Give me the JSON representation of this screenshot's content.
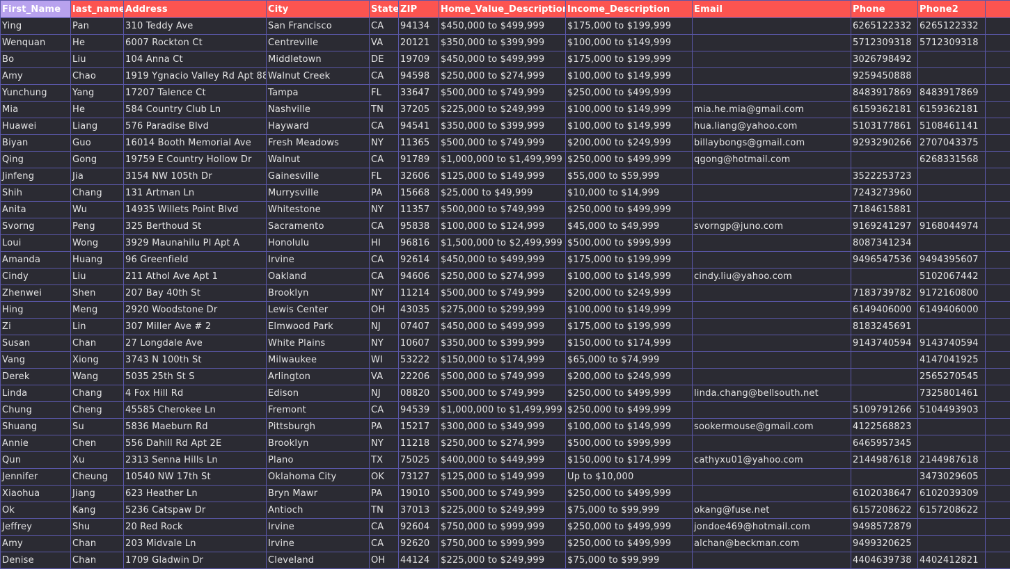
{
  "sheet": {
    "columns": [
      "First_Name",
      "last_name",
      "Address",
      "City",
      "State",
      "ZIP",
      "Home_Value_Description",
      "Income_Description",
      "Email",
      "Phone",
      "Phone2",
      ""
    ],
    "rows": [
      [
        "Ying",
        "Pan",
        "310 Teddy Ave",
        "San Francisco",
        "CA",
        "94134",
        "$450,000 to $499,999",
        "$175,000 to $199,999",
        "",
        "6265122332",
        "6265122332",
        ""
      ],
      [
        "Wenquan",
        "He",
        "6007 Rockton Ct",
        "Centreville",
        "VA",
        "20121",
        "$350,000 to $399,999",
        "$100,000 to $149,999",
        "",
        "5712309318",
        "5712309318",
        ""
      ],
      [
        "Bo",
        "Liu",
        "104 Anna Ct",
        "Middletown",
        "DE",
        "19709",
        "$450,000 to $499,999",
        "$175,000 to $199,999",
        "",
        "3026798492",
        "",
        ""
      ],
      [
        "Amy",
        "Chao",
        "1919 Ygnacio Valley Rd Apt 88",
        "Walnut Creek",
        "CA",
        "94598",
        "$250,000 to $274,999",
        "$100,000 to $149,999",
        "",
        "9259450888",
        "",
        ""
      ],
      [
        "Yunchung",
        "Yang",
        "17207 Talence Ct",
        "Tampa",
        "FL",
        "33647",
        "$500,000 to $749,999",
        "$250,000 to $499,999",
        "",
        "8483917869",
        "8483917869",
        ""
      ],
      [
        "Mia",
        "He",
        "584 Country Club Ln",
        "Nashville",
        "TN",
        "37205",
        "$225,000 to $249,999",
        "$100,000 to $149,999",
        "mia.he.mia@gmail.com",
        "6159362181",
        "6159362181",
        ""
      ],
      [
        "Huawei",
        "Liang",
        "576 Paradise Blvd",
        "Hayward",
        "CA",
        "94541",
        "$350,000 to $399,999",
        "$100,000 to $149,999",
        "hua.liang@yahoo.com",
        "5103177861",
        "5108461141",
        ""
      ],
      [
        "Biyan",
        "Guo",
        "16014 Booth Memorial Ave",
        "Fresh Meadows",
        "NY",
        "11365",
        "$500,000 to $749,999",
        "$200,000 to $249,999",
        "billaybongs@gmail.com",
        "9293290266",
        "2707043375",
        ""
      ],
      [
        "Qing",
        "Gong",
        "19759 E Country Hollow Dr",
        "Walnut",
        "CA",
        "91789",
        "$1,000,000 to $1,499,999",
        "$250,000 to $499,999",
        "qgong@hotmail.com",
        "",
        "6268331568",
        ""
      ],
      [
        "Jinfeng",
        "Jia",
        "3154 NW 105th Dr",
        "Gainesville",
        "FL",
        "32606",
        "$125,000 to $149,999",
        "$55,000 to $59,999",
        "",
        "3522253723",
        "",
        ""
      ],
      [
        "Shih",
        "Chang",
        "131 Artman Ln",
        "Murrysville",
        "PA",
        "15668",
        "$25,000 to $49,999",
        "$10,000 to $14,999",
        "",
        "7243273960",
        "",
        ""
      ],
      [
        "Anita",
        "Wu",
        "14935 Willets Point Blvd",
        "Whitestone",
        "NY",
        "11357",
        "$500,000 to $749,999",
        "$250,000 to $499,999",
        "",
        "7184615881",
        "",
        ""
      ],
      [
        "Svorng",
        "Peng",
        "325 Berthoud St",
        "Sacramento",
        "CA",
        "95838",
        "$100,000  to $124,999",
        "$45,000 to $49,999",
        "svorngp@juno.com",
        "9169241297",
        "9168044974",
        ""
      ],
      [
        "Loui",
        "Wong",
        "3929 Maunahilu Pl Apt A",
        "Honolulu",
        "HI",
        "96816",
        "$1,500,000 to $2,499,999",
        "$500,000 to $999,999",
        "",
        "8087341234",
        "",
        ""
      ],
      [
        "Amanda",
        "Huang",
        "96 Greenfield",
        "Irvine",
        "CA",
        "92614",
        "$450,000 to $499,999",
        "$175,000 to $199,999",
        "",
        "9496547536",
        "9494395607",
        ""
      ],
      [
        "Cindy",
        "Liu",
        "211 Athol Ave Apt 1",
        "Oakland",
        "CA",
        "94606",
        "$250,000 to $274,999",
        "$100,000 to $149,999",
        "cindy.liu@yahoo.com",
        "",
        "5102067442",
        ""
      ],
      [
        "Zhenwei",
        "Shen",
        "207 Bay 40th St",
        "Brooklyn",
        "NY",
        "11214",
        "$500,000 to $749,999",
        "$200,000 to $249,999",
        "",
        "7183739782",
        "9172160800",
        ""
      ],
      [
        "Hing",
        "Meng",
        "2920 Woodstone Dr",
        "Lewis Center",
        "OH",
        "43035",
        "$275,000 to $299,999",
        "$100,000 to $149,999",
        "",
        "6149406000",
        "6149406000",
        ""
      ],
      [
        "Zi",
        "Lin",
        "307 Miller Ave # 2",
        "Elmwood Park",
        "NJ",
        "07407",
        "$450,000 to $499,999",
        "$175,000 to $199,999",
        "",
        "8183245691",
        "",
        ""
      ],
      [
        "Susan",
        "Chan",
        "27 Longdale Ave",
        "White Plains",
        "NY",
        "10607",
        "$350,000 to $399,999",
        "$150,000 to $174,999",
        "",
        "9143740594",
        "9143740594",
        ""
      ],
      [
        "Vang",
        "Xiong",
        "3743 N 100th St",
        "Milwaukee",
        "WI",
        "53222",
        "$150,000 to $174,999",
        "$65,000 to $74,999",
        "",
        "",
        "4147041925",
        ""
      ],
      [
        "Derek",
        "Wang",
        "5035 25th St S",
        "Arlington",
        "VA",
        "22206",
        "$500,000 to $749,999",
        "$200,000 to $249,999",
        "",
        "",
        "2565270545",
        ""
      ],
      [
        "Linda",
        "Chang",
        "4 Fox Hill Rd",
        "Edison",
        "NJ",
        "08820",
        "$500,000 to $749,999",
        "$250,000 to $499,999",
        "linda.chang@bellsouth.net",
        "",
        "7325801461",
        ""
      ],
      [
        "Chung",
        "Cheng",
        "45585 Cherokee Ln",
        "Fremont",
        "CA",
        "94539",
        "$1,000,000 to $1,499,999",
        "$250,000 to $499,999",
        "",
        "5109791266",
        "5104493903",
        ""
      ],
      [
        "Shuang",
        "Su",
        "5836 Maeburn Rd",
        "Pittsburgh",
        "PA",
        "15217",
        "$300,000 to $349,999",
        "$100,000 to $149,999",
        "sookermouse@gmail.com",
        "4122568823",
        "",
        ""
      ],
      [
        "Annie",
        "Chen",
        "556 Dahill Rd Apt 2E",
        "Brooklyn",
        "NY",
        "11218",
        "$250,000 to $274,999",
        "$500,000 to $999,999",
        "",
        "6465957345",
        "",
        ""
      ],
      [
        "Qun",
        "Xu",
        "2313 Senna Hills Ln",
        "Plano",
        "TX",
        "75025",
        "$400,000 to $449,999",
        "$150,000 to $174,999",
        "cathyxu01@yahoo.com",
        "2144987618",
        "2144987618",
        ""
      ],
      [
        "Jennifer",
        "Cheung",
        "10540 NW 17th St",
        "Oklahoma City",
        "OK",
        "73127",
        "$125,000 to $149,999",
        "Up to $10,000",
        "",
        "",
        "3473029605",
        ""
      ],
      [
        "Xiaohua",
        "Jiang",
        "623 Heather Ln",
        "Bryn Mawr",
        "PA",
        "19010",
        "$500,000 to $749,999",
        "$250,000 to $499,999",
        "",
        "6102038647",
        "6102039309",
        ""
      ],
      [
        "Ok",
        "Kang",
        "5236 Catspaw Dr",
        "Antioch",
        "TN",
        "37013",
        "$225,000 to $249,999",
        "$75,000 to $99,999",
        "okang@fuse.net",
        "6157208622",
        "6157208622",
        ""
      ],
      [
        "Jeffrey",
        "Shu",
        "20 Red Rock",
        "Irvine",
        "CA",
        "92604",
        "$750,000 to $999,999",
        "$250,000 to $499,999",
        "jondoe469@hotmail.com",
        "9498572879",
        "",
        ""
      ],
      [
        "Amy",
        "Chan",
        "203 Midvale Ln",
        "Irvine",
        "CA",
        "92620",
        "$750,000 to $999,999",
        "$250,000 to $499,999",
        "alchan@beckman.com",
        "9499320625",
        "",
        ""
      ],
      [
        "Denise",
        "Chan",
        "1709 Gladwin Dr",
        "Cleveland",
        "OH",
        "44124",
        "$225,000 to $249,999",
        "$75,000 to $99,999",
        "",
        "4404639738",
        "4402412821",
        ""
      ]
    ]
  },
  "colors": {
    "header_bg": "#fc5450",
    "selected_header_bg": "#b8a2ee",
    "cell_bg": "#2b2b33",
    "grid_line": "#5a57a8",
    "text": "#e4e4e4"
  }
}
